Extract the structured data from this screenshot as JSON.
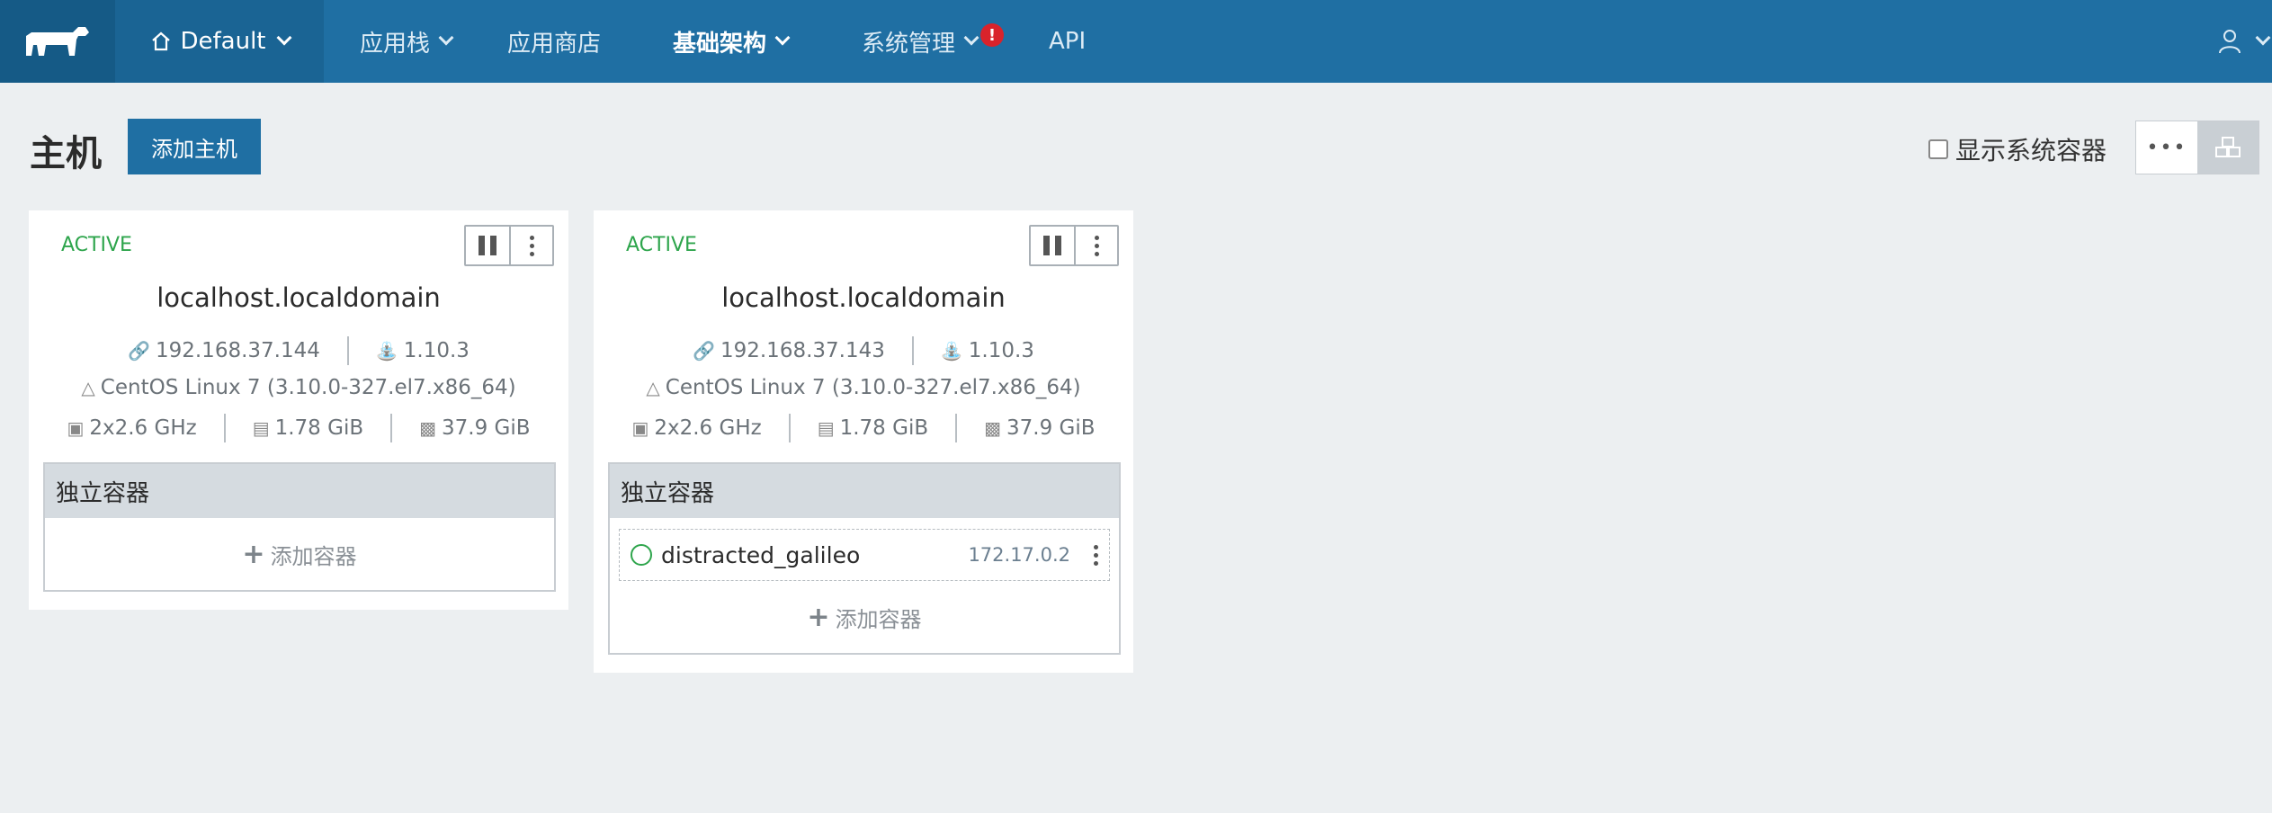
{
  "nav": {
    "environment": "Default",
    "items": [
      {
        "label": "应用栈",
        "has_dropdown": true
      },
      {
        "label": "应用商店",
        "has_dropdown": false
      },
      {
        "label": "基础架构",
        "has_dropdown": true,
        "active": true
      },
      {
        "label": "系统管理",
        "has_dropdown": true,
        "badge": "!"
      },
      {
        "label": "API",
        "has_dropdown": false
      }
    ],
    "colors": {
      "bar": "#1f6fa3",
      "logo_bg": "#155a86",
      "badge": "#d9232b"
    }
  },
  "page": {
    "title": "主机",
    "add_host_label": "添加主机",
    "show_system_label": "显示系统容器",
    "view_list_label": "•••"
  },
  "hosts": [
    {
      "state": "ACTIVE",
      "name": "localhost.localdomain",
      "ip": "192.168.37.144",
      "docker_version": "1.10.3",
      "os": "CentOS Linux 7 (3.10.0-327.el7.x86_64)",
      "cpu": "2x2.6 GHz",
      "memory": "1.78 GiB",
      "storage": "37.9 GiB",
      "section_label": "独立容器",
      "containers": [],
      "add_container_label": "添加容器"
    },
    {
      "state": "ACTIVE",
      "name": "localhost.localdomain",
      "ip": "192.168.37.143",
      "docker_version": "1.10.3",
      "os": "CentOS Linux 7 (3.10.0-327.el7.x86_64)",
      "cpu": "2x2.6 GHz",
      "memory": "1.78 GiB",
      "storage": "37.9 GiB",
      "section_label": "独立容器",
      "containers": [
        {
          "name": "distracted_galileo",
          "ip": "172.17.0.2"
        }
      ],
      "add_container_label": "添加容器"
    }
  ]
}
